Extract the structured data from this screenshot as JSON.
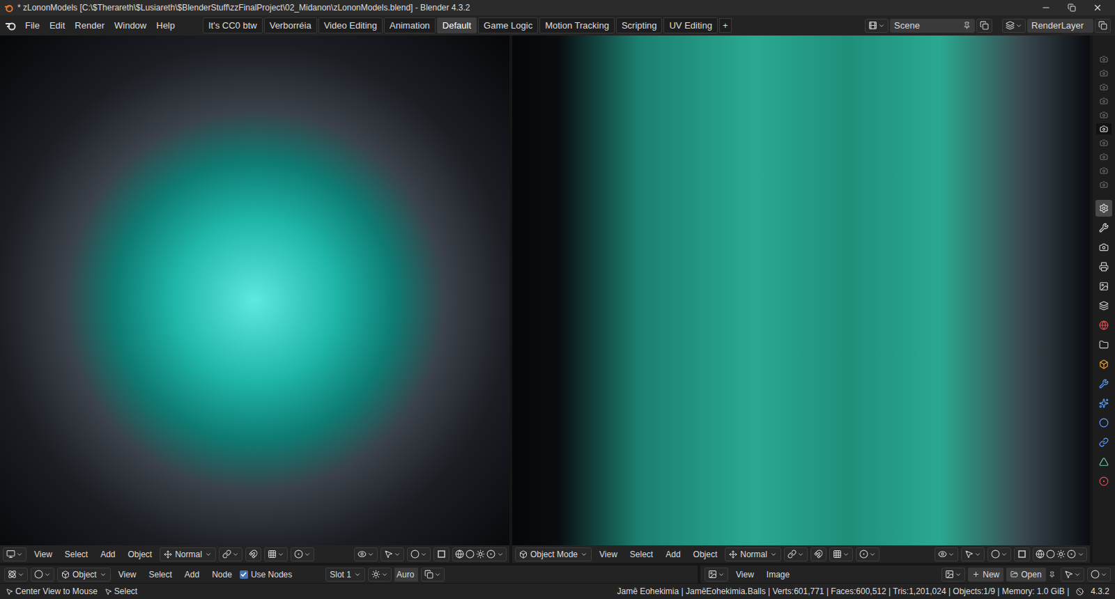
{
  "window": {
    "title": "* zLononModels [C:\\$Therareth\\$Lusiareth\\$BlenderStuff\\zzFinalProject\\02_Midanon\\zLononModels.blend] - Blender 4.3.2"
  },
  "menu": [
    "File",
    "Edit",
    "Render",
    "Window",
    "Help"
  ],
  "workspace_tabs": [
    {
      "label": "It's CC0 btw",
      "selected": false
    },
    {
      "label": "Verborréia",
      "selected": false
    },
    {
      "label": "Video Editing",
      "selected": false
    },
    {
      "label": "Animation",
      "selected": false
    },
    {
      "label": "Default",
      "selected": true
    },
    {
      "label": "Game Logic",
      "selected": false
    },
    {
      "label": "Motion Tracking",
      "selected": false
    },
    {
      "label": "Scripting",
      "selected": false
    },
    {
      "label": "UV Editing",
      "selected": false
    }
  ],
  "add_tab": "+",
  "scene": "Scene",
  "view_layer": "RenderLayer",
  "left_viewport": {
    "menu": [
      "View",
      "Select",
      "Add",
      "Object"
    ],
    "orientation": "Normal"
  },
  "right_viewport": {
    "mode": "Object Mode",
    "menu": [
      "View",
      "Select",
      "Add",
      "Object"
    ],
    "orientation": "Normal"
  },
  "shader_editor": {
    "type": "Object",
    "menu": [
      "View",
      "Select",
      "Add",
      "Node"
    ],
    "use_nodes": {
      "label": "Use Nodes",
      "checked": true
    },
    "slot": "Slot 1",
    "material": "Auro"
  },
  "image_editor": {
    "menu": [
      "View",
      "Image"
    ],
    "buttons": [
      "New",
      "Open"
    ]
  },
  "outliner_rows": [
    {
      "selected": false
    },
    {
      "selected": false
    },
    {
      "selected": false
    },
    {
      "selected": false
    },
    {
      "selected": false
    },
    {
      "selected": true
    },
    {
      "selected": false
    },
    {
      "selected": false
    },
    {
      "selected": false
    },
    {
      "selected": false
    }
  ],
  "property_tabs": [
    {
      "selected": true
    },
    {
      "selected": false
    },
    {
      "selected": false
    },
    {
      "selected": false
    },
    {
      "selected": false
    },
    {
      "selected": false
    },
    {
      "selected": false
    },
    {
      "selected": false
    },
    {
      "selected": false
    },
    {
      "selected": false
    },
    {
      "selected": false
    },
    {
      "selected": false
    },
    {
      "selected": false
    },
    {
      "selected": false
    },
    {
      "selected": false
    }
  ],
  "status_bar": {
    "hints": [
      "Center View to Mouse",
      "Select"
    ],
    "stats": "Jamē Eohekimia | JamēEohekimia.Balls | Verts:601,771 | Faces:600,512 | Tris:1,201,024 | Objects:1/9 | Memory: 1.0 GiB |",
    "version": "4.3.2"
  }
}
